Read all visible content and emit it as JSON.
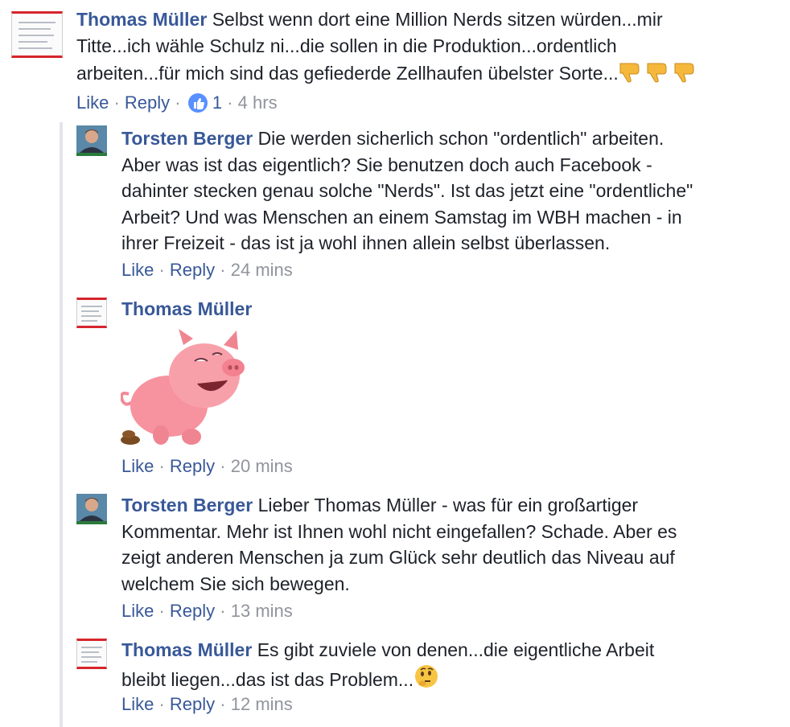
{
  "colors": {
    "link": "#385898",
    "meta": "#90949c",
    "text": "#1d2129",
    "accent_red": "#d6242b"
  },
  "comments": [
    {
      "author": "Thomas Müller",
      "lines": [
        "Selbst wenn dort eine Million Nerds sitzen würden...mir",
        "Titte...ich wähle Schulz ni...die sollen in die Produktion...ordentlich",
        "arbeiten...für mich sind das gefiederde Zellhaufen übelster Sorte..."
      ],
      "emoji": "thumbs-down-icon x3",
      "like": "Like",
      "reply": "Reply",
      "likes_count": "1",
      "time": "4 hrs"
    },
    {
      "author": "Torsten Berger",
      "lines": [
        "Die werden sicherlich schon \"ordentlich\" arbeiten.",
        "Aber was ist das eigentlich? Sie benutzen doch auch Facebook -",
        "dahinter stecken genau solche \"Nerds\". Ist das jetzt eine \"ordentliche\"",
        "Arbeit? Und was Menschen an einem Samstag im WBH machen - in",
        "ihrer Freizeit - das ist ja wohl ihnen allein selbst überlassen."
      ],
      "like": "Like",
      "reply": "Reply",
      "time": "24 mins"
    },
    {
      "author": "Thomas Müller",
      "sticker": "pig-sticker-icon",
      "like": "Like",
      "reply": "Reply",
      "time": "20 mins"
    },
    {
      "author": "Torsten Berger",
      "lines": [
        "Lieber Thomas Müller - was für ein großartiger",
        "Kommentar. Mehr ist Ihnen wohl nicht eingefallen? Schade. Aber es",
        "zeigt anderen Menschen ja zum Glück sehr deutlich das Niveau auf",
        "welchem Sie sich bewegen."
      ],
      "like": "Like",
      "reply": "Reply",
      "time": "13 mins"
    },
    {
      "author": "Thomas Müller",
      "lines": [
        "Es gibt zuviele von denen...die eigentliche Arbeit",
        "bleibt liegen...das ist das Problem..."
      ],
      "emoji": "thinking-face-icon",
      "like": "Like",
      "reply": "Reply",
      "time": "12 mins"
    }
  ]
}
